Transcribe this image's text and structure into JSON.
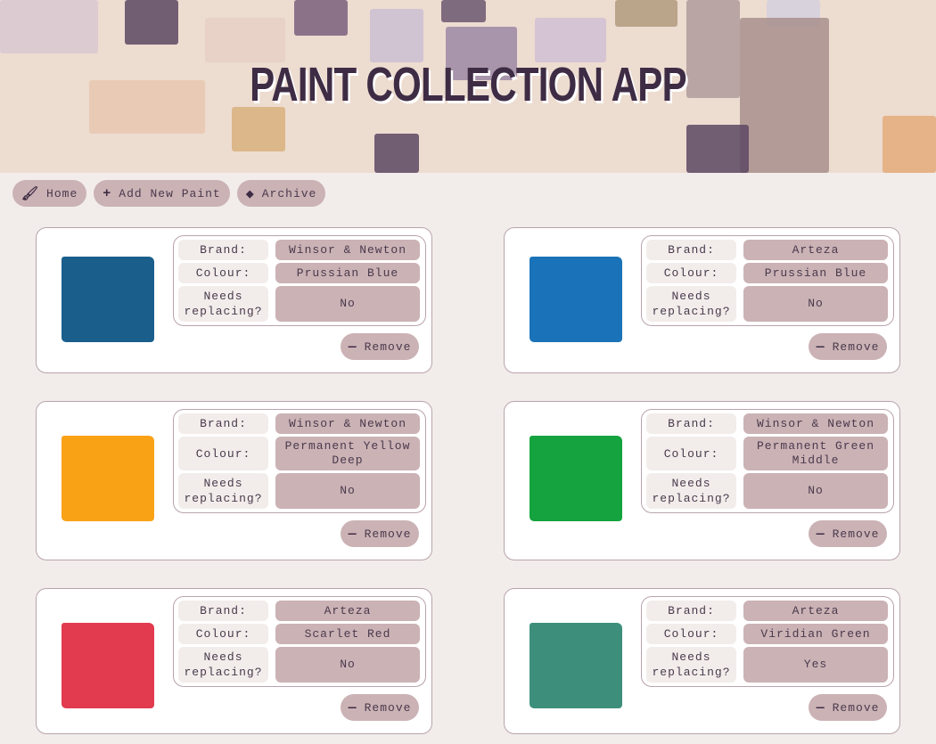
{
  "header": {
    "title": "Paint Collection App"
  },
  "nav": [
    {
      "label": "Home",
      "icon": "paintbrush-icon"
    },
    {
      "label": "Add New Paint",
      "icon": "plus-icon"
    },
    {
      "label": "Archive",
      "icon": "eraser-icon"
    }
  ],
  "labels": {
    "brand": "Brand:",
    "colour": "Colour:",
    "needs": "Needs replacing?",
    "remove": "Remove"
  },
  "paints": [
    {
      "brand": "Winsor & Newton",
      "colour": "Prussian Blue",
      "needs": "No",
      "swatch": "#1a5f8c"
    },
    {
      "brand": "Arteza",
      "colour": "Prussian Blue",
      "needs": "No",
      "swatch": "#1a73b8"
    },
    {
      "brand": "Winsor & Newton",
      "colour": "Permanent Yellow Deep",
      "needs": "No",
      "swatch": "#f9a216"
    },
    {
      "brand": "Winsor & Newton",
      "colour": "Permanent Green Middle",
      "needs": "No",
      "swatch": "#14a33e"
    },
    {
      "brand": "Arteza",
      "colour": "Scarlet Red",
      "needs": "No",
      "swatch": "#e23a4e"
    },
    {
      "brand": "Arteza",
      "colour": "Viridian Green",
      "needs": "Yes",
      "swatch": "#3d8f7c"
    }
  ]
}
